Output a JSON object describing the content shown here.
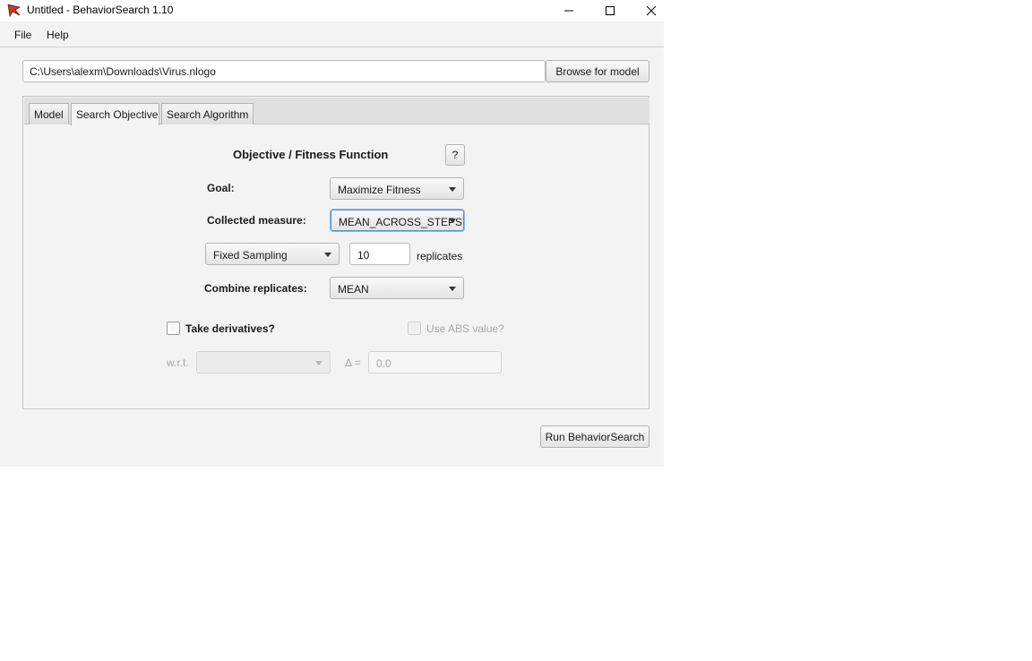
{
  "window": {
    "title": "Untitled - BehaviorSearch 1.10",
    "controls": [
      "minimize-icon",
      "maximize-icon",
      "close-icon"
    ]
  },
  "menu": {
    "items": [
      "File",
      "Help"
    ]
  },
  "model_path": {
    "value": "C:\\Users\\alexm\\Downloads\\Virus.nlogo"
  },
  "browse_button": "Browse for model",
  "tabs": [
    {
      "label": "Model",
      "selected": false
    },
    {
      "label": "Search Objective",
      "selected": true
    },
    {
      "label": "Search Algorithm",
      "selected": false
    }
  ],
  "objective": {
    "heading": "Objective / Fitness Function",
    "help_button": "?",
    "goal_label": "Goal:",
    "goal_value": "Maximize Fitness",
    "measure_label": "Collected measure:",
    "measure_value": "MEAN_ACROSS_STEPS",
    "sampling_value": "Fixed Sampling",
    "replicates_value": "10",
    "replicates_label": "replicates",
    "combine_label": "Combine replicates:",
    "combine_value": "MEAN",
    "derivatives_label": "Take derivatives?",
    "abs_label": "Use ABS value?",
    "wrt_label": "w.r.t.",
    "wrt_value": "",
    "delta_label": "Δ =",
    "delta_placeholder": "0.0"
  },
  "run_button": "Run BehaviorSearch",
  "colors": {
    "focus": "#4a90d9",
    "app_icon": "#c0392b"
  }
}
